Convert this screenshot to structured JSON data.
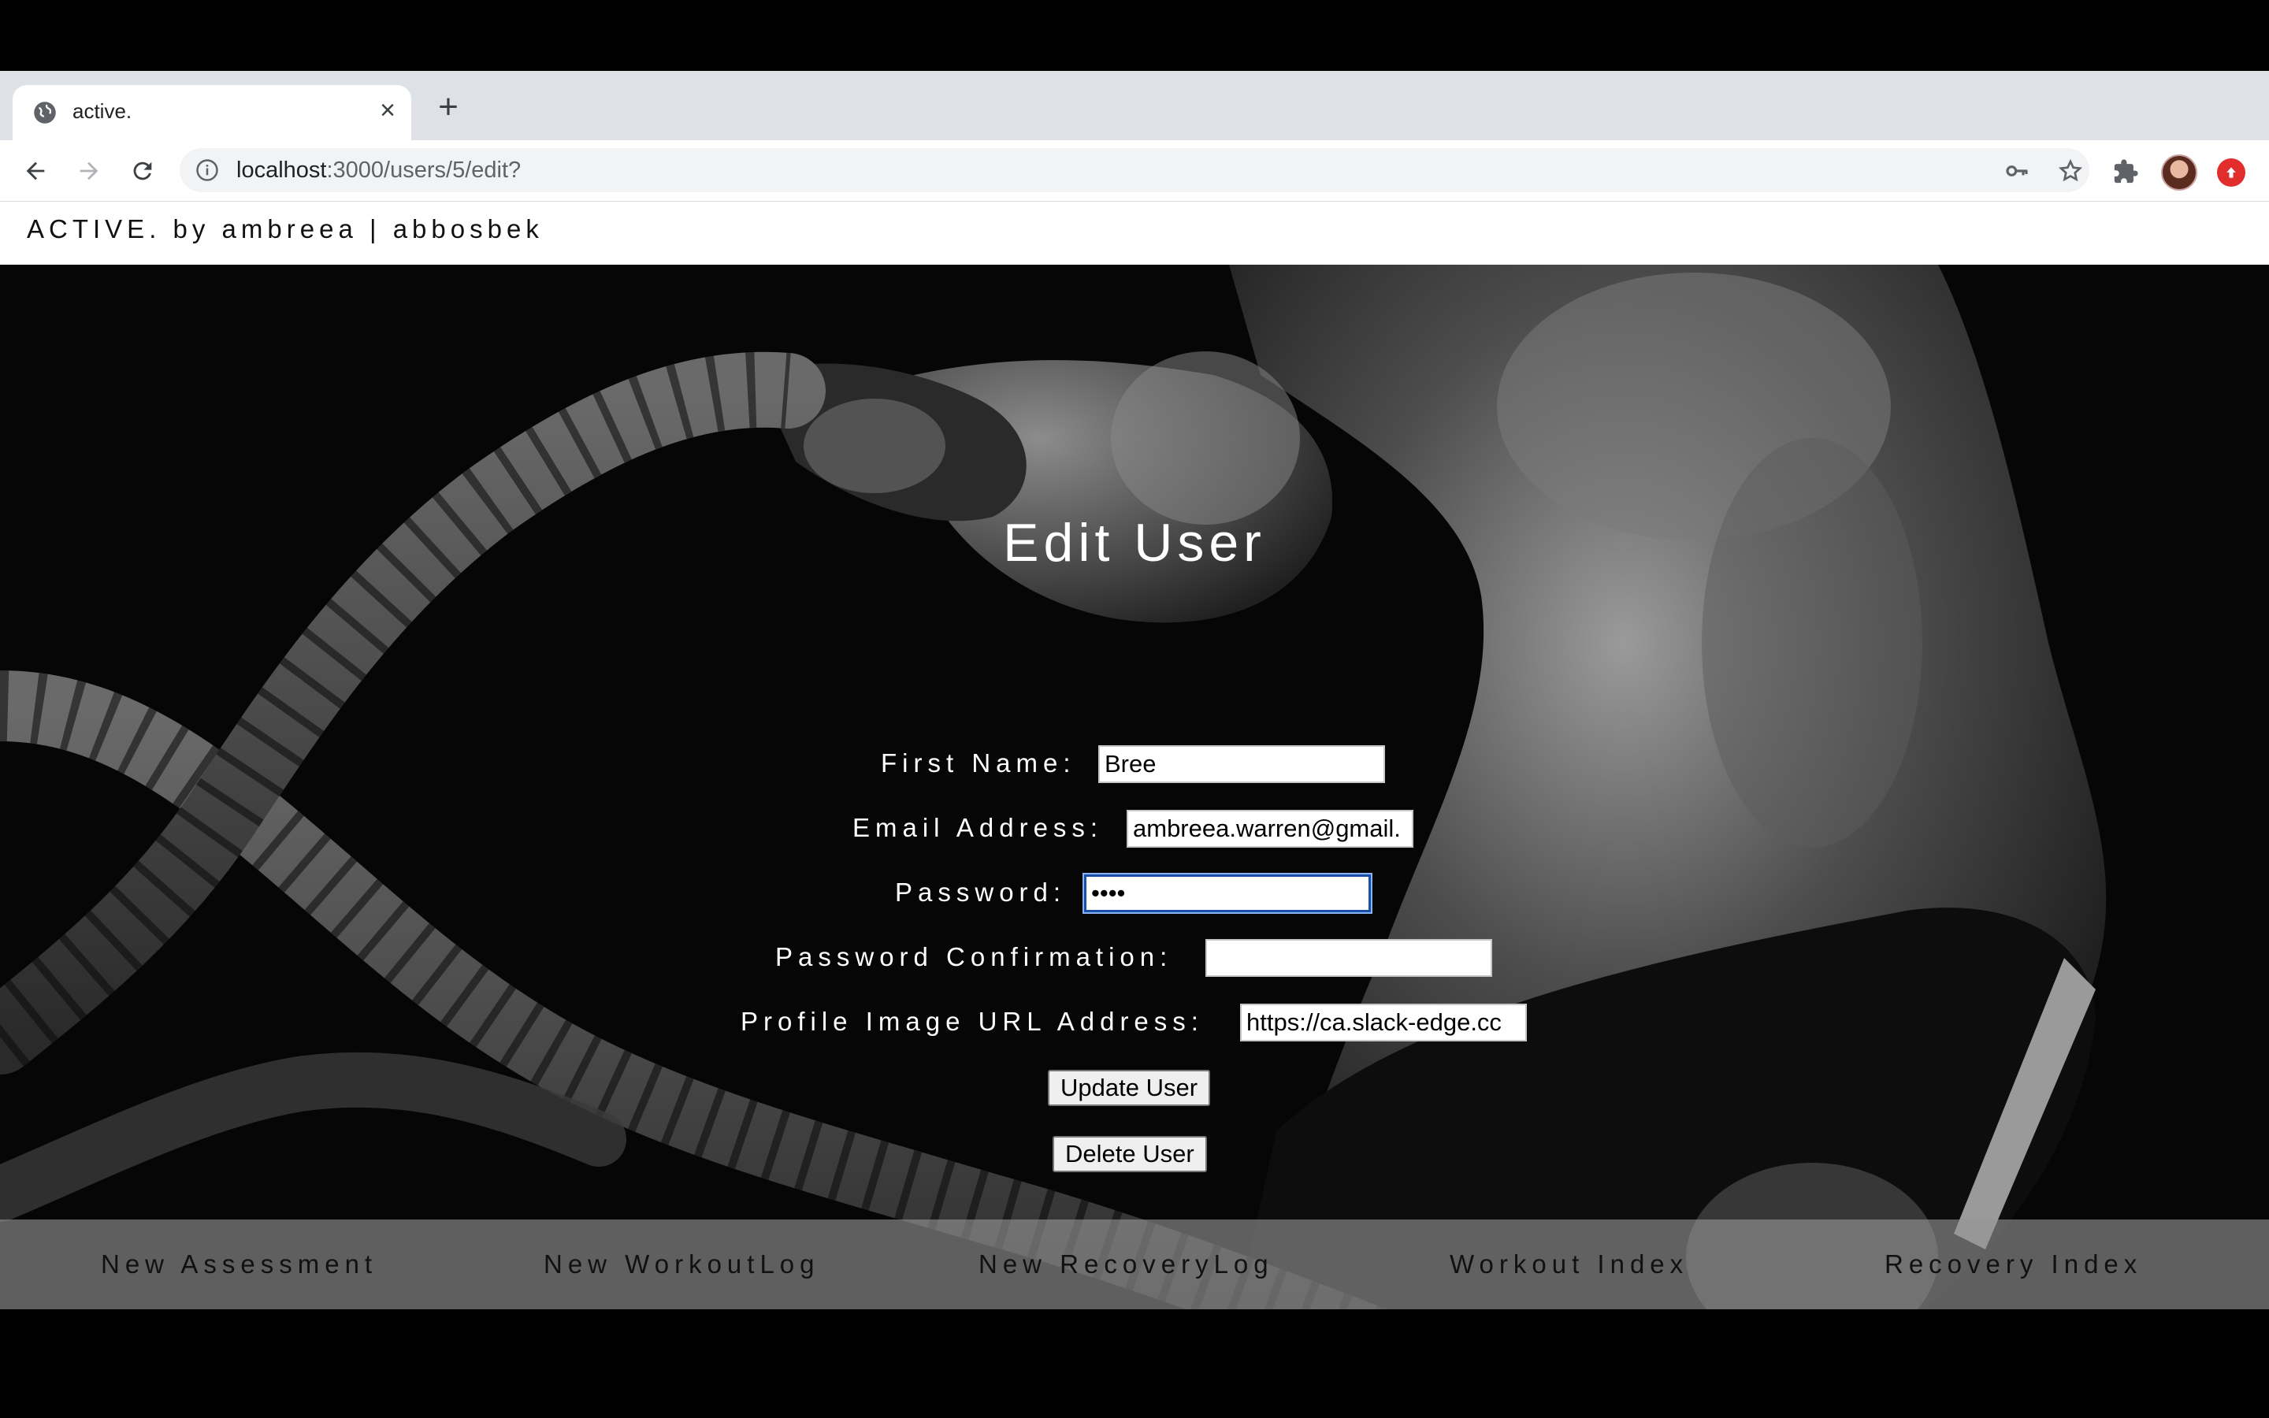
{
  "browser": {
    "tab": {
      "title": "active.",
      "close_icon": "close-icon",
      "favicon": "globe-icon"
    },
    "new_tab_icon": "plus-icon",
    "address": {
      "host": "localhost",
      "path": ":3000/users/5/edit?"
    },
    "icons": [
      "back-arrow-icon",
      "forward-arrow-icon",
      "reload-icon",
      "info-icon",
      "key-icon",
      "star-icon",
      "puzzle-icon",
      "avatar",
      "extension-icon"
    ]
  },
  "site": {
    "brand": "ACTIVE. by ambreea | abbosbek"
  },
  "form": {
    "title": "Edit User",
    "first_name": {
      "label": "First Name:",
      "value": "Bree"
    },
    "email": {
      "label": "Email Address:",
      "value": "ambreea.warren@gmail."
    },
    "password": {
      "label": "Password:",
      "value": "••••"
    },
    "password_confirmation": {
      "label": "Password Confirmation:",
      "value": ""
    },
    "image_url": {
      "label": "Profile Image URL Address:",
      "value": "https://ca.slack-edge.cc"
    },
    "update_label": "Update User",
    "delete_label": "Delete User"
  },
  "footer_nav": [
    "New Assessment",
    "New WorkoutLog",
    "New RecoveryLog",
    "Workout Index",
    "Recovery Index"
  ],
  "colors": {
    "tabstrip": "#dee1e6",
    "focus_ring": "#1a4fa8",
    "footer_bg": "#969696"
  }
}
